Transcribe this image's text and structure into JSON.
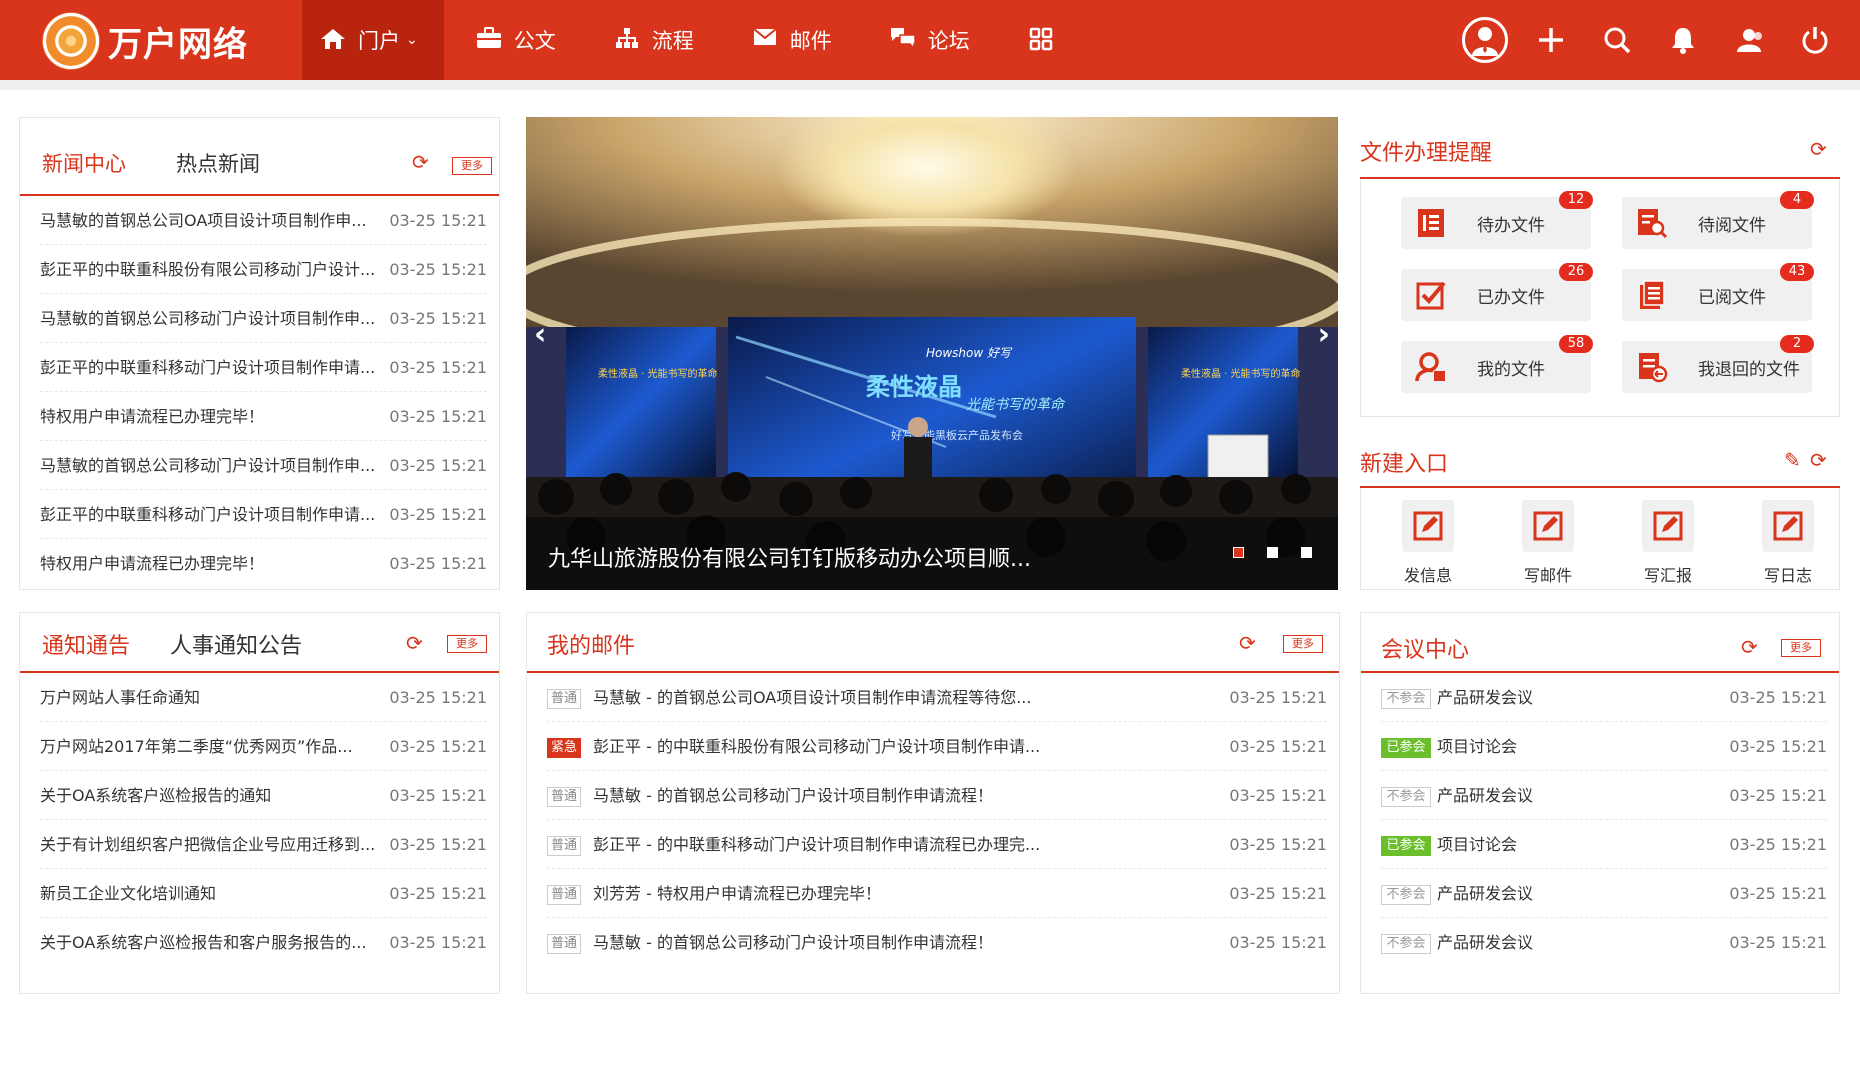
{
  "header": {
    "brand": "万户网络",
    "nav": [
      {
        "label": "门户",
        "icon": "home-icon"
      },
      {
        "label": "公文",
        "icon": "briefcase-icon"
      },
      {
        "label": "流程",
        "icon": "flow-icon"
      },
      {
        "label": "邮件",
        "icon": "mail-icon"
      },
      {
        "label": "论坛",
        "icon": "forum-icon"
      },
      {
        "label": "",
        "icon": "apps-grid-icon"
      }
    ],
    "actions": [
      "avatar",
      "plus-icon",
      "search-icon",
      "bell-icon",
      "contacts-icon",
      "power-icon"
    ]
  },
  "news": {
    "tabs": [
      "新闻中心",
      "热点新闻"
    ],
    "more": "更多",
    "items": [
      {
        "title": "马慧敏的首钢总公司OA项目设计项目制作申...",
        "date": "03-25 15:21"
      },
      {
        "title": "彭正平的中联重科股份有限公司移动门户设计...",
        "date": "03-25 15:21"
      },
      {
        "title": "马慧敏的首钢总公司移动门户设计项目制作申...",
        "date": "03-25 15:21"
      },
      {
        "title": "彭正平的中联重科移动门户设计项目制作申请...",
        "date": "03-25 15:21"
      },
      {
        "title": "特权用户申请流程已办理完毕！",
        "date": "03-25 15:21"
      },
      {
        "title": "马慧敏的首钢总公司移动门户设计项目制作申...",
        "date": "03-25 15:21"
      },
      {
        "title": "彭正平的中联重科移动门户设计项目制作申请...",
        "date": "03-25 15:21"
      },
      {
        "title": "特权用户申请流程已办理完毕！",
        "date": "03-25 15:21"
      }
    ]
  },
  "banner": {
    "caption": "九华山旅游股份有限公司钉钉版移动办公项目顺...",
    "slogan": "柔性液晶",
    "slogan2": "光能书写的革命",
    "brand": "Howshow 好写",
    "subtitle": "好写光能黑板云产品发布会",
    "side_title": "柔性液晶 · 光能书写的革命",
    "slides": 3,
    "active_slide": 1
  },
  "files": {
    "title": "文件办理提醒",
    "items": [
      {
        "label": "待办文件",
        "count": "12",
        "icon": "todo-doc-icon"
      },
      {
        "label": "待阅文件",
        "count": "4",
        "icon": "to-read-doc-icon"
      },
      {
        "label": "已办文件",
        "count": "26",
        "icon": "done-doc-icon"
      },
      {
        "label": "已阅文件",
        "count": "43",
        "icon": "read-doc-icon"
      },
      {
        "label": "我的文件",
        "count": "58",
        "icon": "my-doc-icon"
      },
      {
        "label": "我退回的文件",
        "count": "2",
        "icon": "returned-doc-icon"
      }
    ]
  },
  "entries": {
    "title": "新建入口",
    "items": [
      {
        "label": "发信息",
        "icon": "edit-icon"
      },
      {
        "label": "写邮件",
        "icon": "edit-icon"
      },
      {
        "label": "写汇报",
        "icon": "edit-icon"
      },
      {
        "label": "写日志",
        "icon": "edit-icon"
      }
    ]
  },
  "notice": {
    "tabs": [
      "通知通告",
      "人事通知公告"
    ],
    "more": "更多",
    "items": [
      {
        "title": "万户网站人事任命通知",
        "date": "03-25 15:21"
      },
      {
        "title": "万户网站2017年第二季度“优秀网页”作品...",
        "date": "03-25 15:21"
      },
      {
        "title": "关于OA系统客户巡检报告的通知",
        "date": "03-25 15:21"
      },
      {
        "title": "关于有计划组织客户把微信企业号应用迁移到...",
        "date": "03-25 15:21"
      },
      {
        "title": "新员工企业文化培训通知",
        "date": "03-25 15:21"
      },
      {
        "title": "关于OA系统客户巡检报告和客户服务报告的...",
        "date": "03-25 15:21"
      }
    ]
  },
  "mail": {
    "title": "我的邮件",
    "more": "更多",
    "items": [
      {
        "tag": "普通",
        "urgent": false,
        "title": "马慧敏 - 的首钢总公司OA项目设计项目制作申请流程等待您...",
        "date": "03-25 15:21"
      },
      {
        "tag": "紧急",
        "urgent": true,
        "title": "彭正平 - 的中联重科股份有限公司移动门户设计项目制作申请...",
        "date": "03-25 15:21"
      },
      {
        "tag": "普通",
        "urgent": false,
        "title": "马慧敏 - 的首钢总公司移动门户设计项目制作申请流程！",
        "date": "03-25 15:21"
      },
      {
        "tag": "普通",
        "urgent": false,
        "title": "彭正平 - 的中联重科移动门户设计项目制作申请流程已办理完...",
        "date": "03-25 15:21"
      },
      {
        "tag": "普通",
        "urgent": false,
        "title": "刘芳芳 - 特权用户申请流程已办理完毕！",
        "date": "03-25 15:21"
      },
      {
        "tag": "普通",
        "urgent": false,
        "title": "马慧敏 - 的首钢总公司移动门户设计项目制作申请流程！",
        "date": "03-25 15:21"
      }
    ]
  },
  "meeting": {
    "title": "会议中心",
    "more": "更多",
    "items": [
      {
        "tag": "不参会",
        "joined": false,
        "title": "产品研发会议",
        "date": "03-25 15:21"
      },
      {
        "tag": "已参会",
        "joined": true,
        "title": "项目讨论会",
        "date": "03-25 15:21"
      },
      {
        "tag": "不参会",
        "joined": false,
        "title": "产品研发会议",
        "date": "03-25 15:21"
      },
      {
        "tag": "已参会",
        "joined": true,
        "title": "项目讨论会",
        "date": "03-25 15:21"
      },
      {
        "tag": "不参会",
        "joined": false,
        "title": "产品研发会议",
        "date": "03-25 15:21"
      },
      {
        "tag": "不参会",
        "joined": false,
        "title": "产品研发会议",
        "date": "03-25 15:21"
      }
    ]
  },
  "colors": {
    "brand": "#d9341c",
    "brand_dark": "#b9240f",
    "urgent": "#d9341c",
    "joined": "#6bbf2c",
    "badge": "#e52b1e"
  }
}
